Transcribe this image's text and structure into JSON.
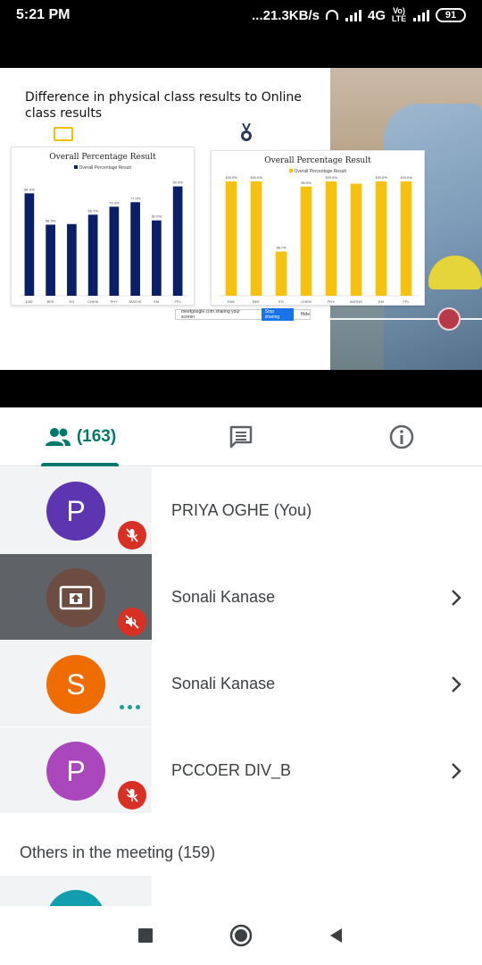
{
  "status_bar": {
    "time": "5:21 PM",
    "network_speed": "...21.3KB/s",
    "network_type": "4G",
    "volte_label": "Vo) LTE",
    "battery": "91"
  },
  "slide": {
    "title": "Difference in physical class results to Online class results",
    "share_bar": {
      "text": "meetgoogle.com sharing your screen",
      "stop_label": "Stop sharing",
      "hide_label": "Hide"
    }
  },
  "chart_data": [
    {
      "type": "bar",
      "title": "Overall Percentage Result",
      "legend": [
        "Overall Percentage Result"
      ],
      "color": "#0b1f66",
      "categories": [
        "EAE",
        "BEE",
        "EG",
        "CHEM",
        "PHY",
        "MATHS",
        "EM",
        "FPL"
      ],
      "values": [
        84.3,
        58.5,
        59.0,
        66.7,
        73.3,
        77.0,
        62.0,
        90.0
      ],
      "data_labels": [
        "84.3%",
        "58.5%",
        "",
        "66.7%",
        "73.3%",
        "77.0%",
        "62.0%",
        "90.0%"
      ]
    },
    {
      "type": "bar",
      "title": "Overall Percentage Result",
      "legend": [
        "Overall Percentage Result"
      ],
      "color": "#f7c20f",
      "categories": [
        "EAE",
        "BEE",
        "EG",
        "CHEM",
        "PHY",
        "MATHS",
        "EM",
        "FPL"
      ],
      "values": [
        100,
        100,
        38.7,
        95.5,
        100,
        98,
        100,
        100
      ],
      "data_labels": [
        "100.0%",
        "100.0%",
        "38.7%",
        "95.5%",
        "100.0%",
        "",
        "100.0%",
        "100.0%"
      ]
    }
  ],
  "tabs": {
    "people_count": "(163)",
    "people_icon": "people-icon",
    "chat_icon": "chat-icon",
    "info_icon": "info-icon"
  },
  "participants": [
    {
      "initial": "P",
      "name": "PRIYA OGHE (You)",
      "avatar_color": "#5e35b1",
      "muted": true,
      "chevron": false
    },
    {
      "initial": "",
      "name": "Sonali Kanase",
      "avatar_color": "#6d4c41",
      "muted": true,
      "presenting": true,
      "chevron": true
    },
    {
      "initial": "S",
      "name": "Sonali Kanase",
      "avatar_color": "#ef6c00",
      "muted": false,
      "speaking": true,
      "chevron": true
    },
    {
      "initial": "P",
      "name": "PCCOER DIV_B",
      "avatar_color": "#ab47bc",
      "muted": true,
      "chevron": true
    }
  ],
  "others_section": {
    "title": "Others in the meeting (159)"
  },
  "colors": {
    "accent": "#00796b",
    "mute_red": "#d93025"
  }
}
